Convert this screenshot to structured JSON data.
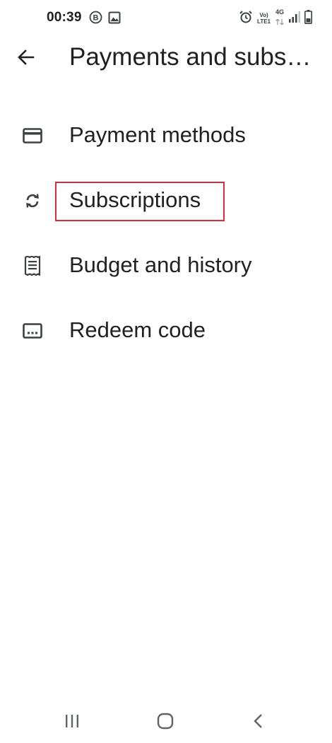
{
  "status_bar": {
    "time": "00:39",
    "network_top": "Vo)",
    "network_bottom": "LTE1",
    "network_type": "4G"
  },
  "app_bar": {
    "title": "Payments and subscriptions"
  },
  "menu": {
    "items": [
      {
        "label": "Payment methods",
        "icon": "credit-card-icon"
      },
      {
        "label": "Subscriptions",
        "icon": "sync-icon"
      },
      {
        "label": "Budget and history",
        "icon": "receipt-icon"
      },
      {
        "label": "Redeem code",
        "icon": "redeem-code-icon"
      }
    ]
  },
  "annotation": {
    "highlight_color": "#d32f3a"
  },
  "nav_bar": {
    "icons": [
      "recent-apps-icon",
      "home-icon",
      "back-icon"
    ]
  }
}
